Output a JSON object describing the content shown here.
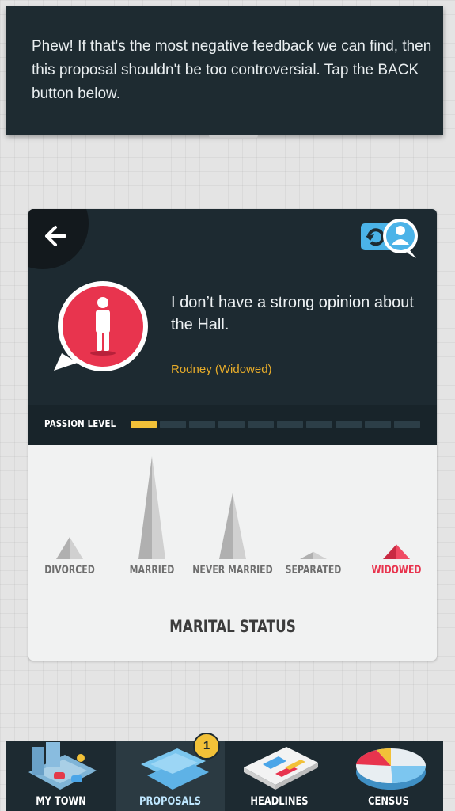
{
  "tooltip": {
    "message": "Phew! If that's the most negative feedback we can find, then this proposal shouldn't be too controversial. Tap the BACK button below."
  },
  "feedback": {
    "quote": "I don’t have a strong opinion about the Hall.",
    "speaker": "Rodney (Widowed)",
    "passion_label": "PASSION LEVEL",
    "passion_level": 1,
    "passion_max": 10
  },
  "colors": {
    "panel": "#1d2a31",
    "accent_yellow": "#f2c138",
    "speaker_orange": "#e7ac2a",
    "avatar_red": "#e8344e",
    "highlight_red": "#e8344e",
    "bar_gray": "#bdbdbd"
  },
  "chart_data": {
    "type": "bar",
    "categories": [
      "DIVORCED",
      "MARRIED",
      "NEVER MARRIED",
      "SEPARATED",
      "WIDOWED"
    ],
    "values": [
      3,
      14,
      9,
      1,
      2
    ],
    "highlight": "WIDOWED",
    "xlabel": "MARITAL STATUS",
    "ylabel": "",
    "ylim": [
      0,
      14
    ]
  },
  "nav": {
    "items": [
      {
        "label": "MY TOWN",
        "icon": "town-icon"
      },
      {
        "label": "PROPOSALS",
        "icon": "proposals-icon",
        "badge": "1",
        "active": true
      },
      {
        "label": "HEADLINES",
        "icon": "newspaper-icon"
      },
      {
        "label": "CENSUS",
        "icon": "pie-chart-icon"
      }
    ]
  }
}
